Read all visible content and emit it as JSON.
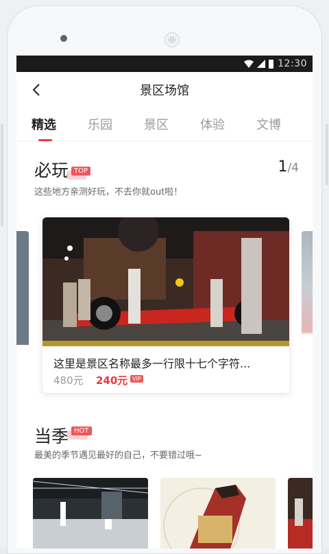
{
  "status": {
    "time": "12:30"
  },
  "navbar": {
    "title": "景区场馆"
  },
  "tabs": [
    {
      "label": "精选",
      "active": true
    },
    {
      "label": "乐园",
      "active": false
    },
    {
      "label": "景区",
      "active": false
    },
    {
      "label": "体验",
      "active": false
    },
    {
      "label": "文博",
      "active": false
    }
  ],
  "section_must_play": {
    "title": "必玩",
    "tag": "TOP",
    "pager_current": "1",
    "pager_total": "/4",
    "subtitle": "这些地方亲测好玩，不去你就out啦！",
    "card": {
      "title": "这里是景区名称最多一行限十七个字符...",
      "price_old": "480元",
      "price_new": "240元",
      "vip_tag": "VIP"
    }
  },
  "section_season": {
    "title": "当季",
    "tag": "HOT",
    "subtitle": "最美的季节遇见最好的自己，不要错过哦~"
  },
  "colors": {
    "accent": "#e8393c",
    "tag": "#f0565a"
  }
}
